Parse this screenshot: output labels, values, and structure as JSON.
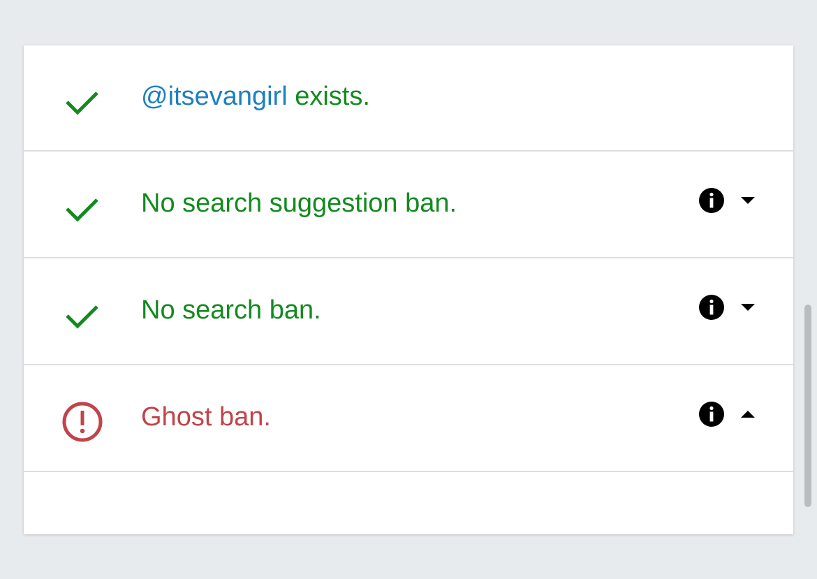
{
  "colors": {
    "success": "#138a1f",
    "handle": "#1d7fc1",
    "error": "#c0444a",
    "page_background": "#e8ebee",
    "card_background": "#ffffff",
    "divider": "#dcdfe2"
  },
  "results": {
    "exists": {
      "status_icon": "check-icon",
      "handle": "@itsevangirl",
      "text": " exists."
    },
    "search_suggestion_ban": {
      "status_icon": "check-icon",
      "text": "No search suggestion ban.",
      "info_icon": "info-icon",
      "toggle_icon": "caret-down-icon"
    },
    "search_ban": {
      "status_icon": "check-icon",
      "text": "No search ban.",
      "info_icon": "info-icon",
      "toggle_icon": "caret-down-icon"
    },
    "ghost_ban": {
      "status_icon": "alert-circle-icon",
      "text": "Ghost ban.",
      "info_icon": "info-icon",
      "toggle_icon": "caret-up-icon"
    }
  }
}
